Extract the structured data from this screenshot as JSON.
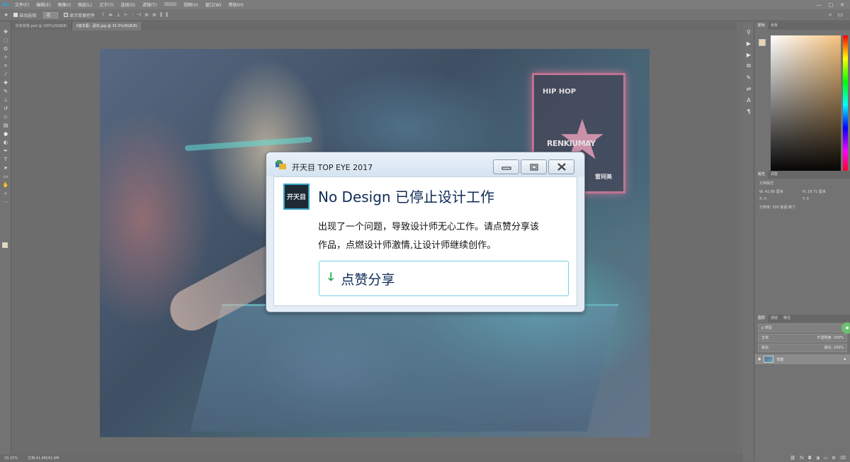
{
  "app": {
    "logo": "Ps"
  },
  "menu": [
    "文件(F)",
    "编辑(E)",
    "图像(I)",
    "图层(L)",
    "文字(Y)",
    "选择(S)",
    "滤镜(T)",
    "3D(D)",
    "视图(V)",
    "窗口(W)",
    "帮助(H)"
  ],
  "window_controls": [
    "—",
    "□",
    "✕"
  ],
  "options": {
    "auto_select_label": "自动选择:",
    "auto_select_value": "组",
    "show_transform_label": "显示变换控件"
  },
  "tabs": [
    {
      "label": "红色背景.psd @ 100%(RGB/8)"
    },
    {
      "label": "0基本图 - 副本.jpg @ 33.3%(RGB/8)"
    }
  ],
  "panels": {
    "color_tabs": [
      "颜色",
      "色板"
    ],
    "props_tabs": [
      "属性",
      "调整"
    ],
    "props_title": "文档属性",
    "props_w": "W: 42.86 厘米",
    "props_h": "H: 29.71 厘米",
    "props_x": "X: 0",
    "props_y": "Y: 0",
    "props_res": "分辨率: 300 像素/英寸",
    "layers_tabs": [
      "图层",
      "通道",
      "路径"
    ],
    "layer_kind": "ρ 类型",
    "layer_blend": "正常",
    "layer_opacity": "不透明度: 100%",
    "layer_fill": "填充: 100%",
    "layer_lock": "锁定:",
    "layer_name": "背景"
  },
  "status": {
    "zoom": "33.33%",
    "doc": "文档:41.6M/41.6M"
  },
  "artwork": {
    "neon_title": "HIP HOP",
    "neon_brand": "RENKIUMAY",
    "neon_sub": "雷珂美"
  },
  "dialog": {
    "title": "开天目 TOP EYE  2017",
    "logo_text": "开天目",
    "heading": "No Design  已停止设计工作",
    "message_line1": "出现了一个问题，导致设计师无心工作。请点赞分享该",
    "message_line2": "作品，点燃设计师激情,让设计师继续创作。",
    "action_label": "点赞分享",
    "colors": {
      "accent": "#70d2e4",
      "heading": "#0f2c57",
      "arrow": "#17a34a"
    }
  }
}
